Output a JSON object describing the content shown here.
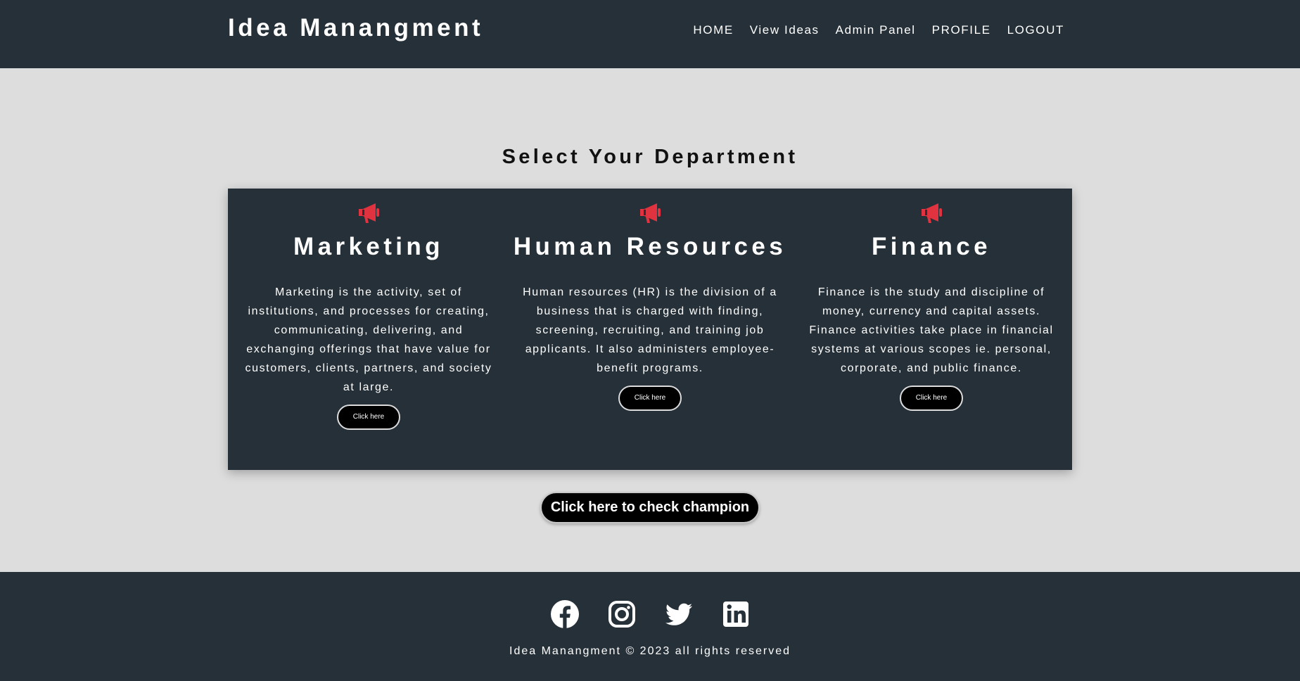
{
  "header": {
    "brand": "Idea Manangment",
    "nav": [
      "HOME",
      "View Ideas",
      "Admin Panel",
      "PROFILE",
      "LOGOUT"
    ]
  },
  "main": {
    "title": "Select Your Department",
    "departments": [
      {
        "icon": "megaphone-icon",
        "name": "Marketing",
        "description": "Marketing is the activity, set of institutions, and processes for creating, communicating, delivering, and exchanging offerings that have value for customers, clients, partners, and society at large.",
        "button": "Click here"
      },
      {
        "icon": "megaphone-icon",
        "name": "Human Resources",
        "description": "Human resources (HR) is the division of a business that is charged with finding, screening, recruiting, and training job applicants. It also administers employee-benefit programs.",
        "button": "Click here"
      },
      {
        "icon": "megaphone-icon",
        "name": "Finance",
        "description": "Finance is the study and discipline of money, currency and capital assets. Finance activities take place in financial systems at various scopes ie. personal, corporate, and public finance.",
        "button": "Click here"
      }
    ],
    "champion_button": "Click here to check champion"
  },
  "footer": {
    "socials": [
      "facebook-icon",
      "instagram-icon",
      "twitter-icon",
      "linkedin-icon"
    ],
    "copyright": "Idea Manangment © 2023 all rights reserved"
  },
  "colors": {
    "header_bg": "#263038",
    "page_bg": "#dddddd",
    "accent": "#e0323f",
    "button_bg": "#000000"
  }
}
